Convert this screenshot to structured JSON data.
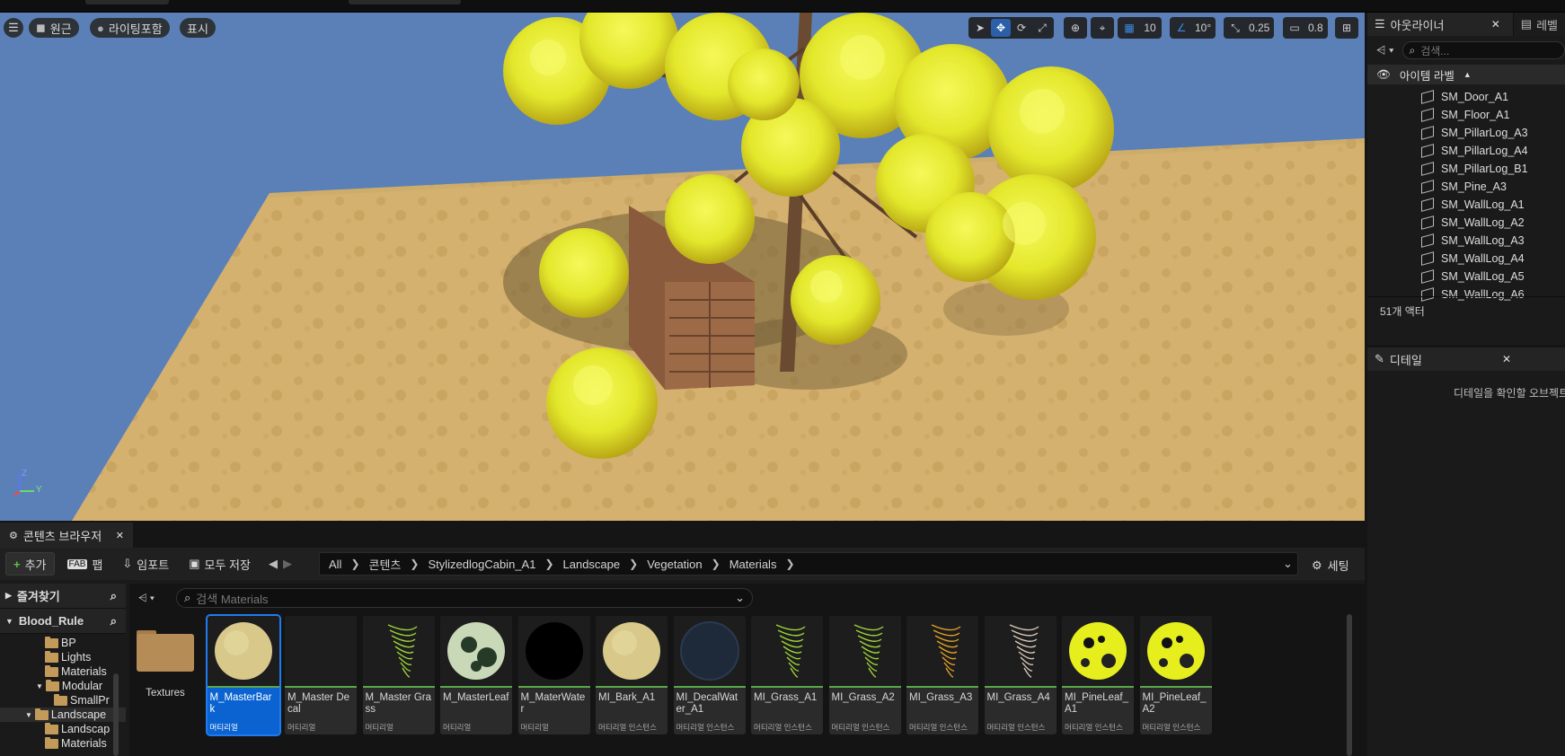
{
  "viewport": {
    "menu_icon": "hamburger-icon",
    "perspective_label": "원근",
    "lit_label": "라이팅포함",
    "show_label": "표시",
    "grid_snap_value": "10",
    "rotation_snap_value": "10°",
    "scale_snap_value": "0.25",
    "camera_speed_value": "0.8",
    "axis_labels": {
      "z": "Z",
      "y": "Y"
    }
  },
  "outliner": {
    "tab_label": "아웃라이너",
    "other_tab_label": "레벨",
    "search_placeholder": "검색...",
    "column_label": "아이템 라벨",
    "items": [
      "SM_Door_A1",
      "SM_Floor_A1",
      "SM_PillarLog_A3",
      "SM_PillarLog_A4",
      "SM_PillarLog_B1",
      "SM_Pine_A3",
      "SM_WallLog_A1",
      "SM_WallLog_A2",
      "SM_WallLog_A3",
      "SM_WallLog_A4",
      "SM_WallLog_A5",
      "SM_WallLog_A6"
    ],
    "actor_count": "51개 액터"
  },
  "details": {
    "tab_label": "디테일",
    "empty_message": "디테일을 확인할 오브젝트"
  },
  "content_browser": {
    "tab_label": "콘텐츠 브라우저",
    "add_label": "추가",
    "import_label": "임포트",
    "save_all_label": "모두 저장",
    "settings_label": "세팅",
    "breadcrumbs": [
      "All",
      "콘텐츠",
      "StylizedlogCabin_A1",
      "Landscape",
      "Vegetation",
      "Materials"
    ],
    "favorites_label": "즐겨찾기",
    "project_label": "Blood_Rule",
    "search_placeholder": "검색 Materials",
    "tree": [
      {
        "label": "BP",
        "depth": 3
      },
      {
        "label": "Lights",
        "depth": 3
      },
      {
        "label": "Materials",
        "depth": 3
      },
      {
        "label": "Modular",
        "depth": 2
      },
      {
        "label": "SmallPr",
        "depth": 4
      },
      {
        "label": "Landscape",
        "depth": 1
      },
      {
        "label": "Landscap",
        "depth": 3
      },
      {
        "label": "Materials",
        "depth": 3
      }
    ],
    "assets": [
      {
        "name": "Textures",
        "type": "",
        "kind": "folder"
      },
      {
        "name": "M_MasterBark",
        "type": "머티리얼",
        "kind": "bark"
      },
      {
        "name": "M_Master Decal",
        "type": "머티리얼",
        "kind": "empty"
      },
      {
        "name": "M_Master Grass",
        "type": "머티리얼",
        "kind": "grass"
      },
      {
        "name": "M_MasterLeaf",
        "type": "머티리얼",
        "kind": "leaf"
      },
      {
        "name": "M_MaterWater",
        "type": "머티리얼",
        "kind": "black"
      },
      {
        "name": "MI_Bark_A1",
        "type": "머티리얼 인스턴스",
        "kind": "bark"
      },
      {
        "name": "MI_DecalWater_A1",
        "type": "머티리얼 인스턴스",
        "kind": "water"
      },
      {
        "name": "MI_Grass_A1",
        "type": "머티리얼 인스턴스",
        "kind": "grass"
      },
      {
        "name": "MI_Grass_A2",
        "type": "머티리얼 인스턴스",
        "kind": "grass"
      },
      {
        "name": "MI_Grass_A3",
        "type": "머티리얼 인스턴스",
        "kind": "grass_orange"
      },
      {
        "name": "MI_Grass_A4",
        "type": "머티리얼 인스턴스",
        "kind": "grass_white"
      },
      {
        "name": "MI_PineLeaf_A1",
        "type": "머티리얼 인스턴스",
        "kind": "pine"
      },
      {
        "name": "MI_PineLeaf_A2",
        "type": "머티리얼 인스턴스",
        "kind": "pine"
      }
    ],
    "selected_asset": "M_MasterBark"
  },
  "colors": {
    "accent": "#0a63d1",
    "material_bar": "#5aa84a",
    "ground": "#d4b16e",
    "sky": "#5b80b7",
    "foliage": "#e4ec2c"
  }
}
